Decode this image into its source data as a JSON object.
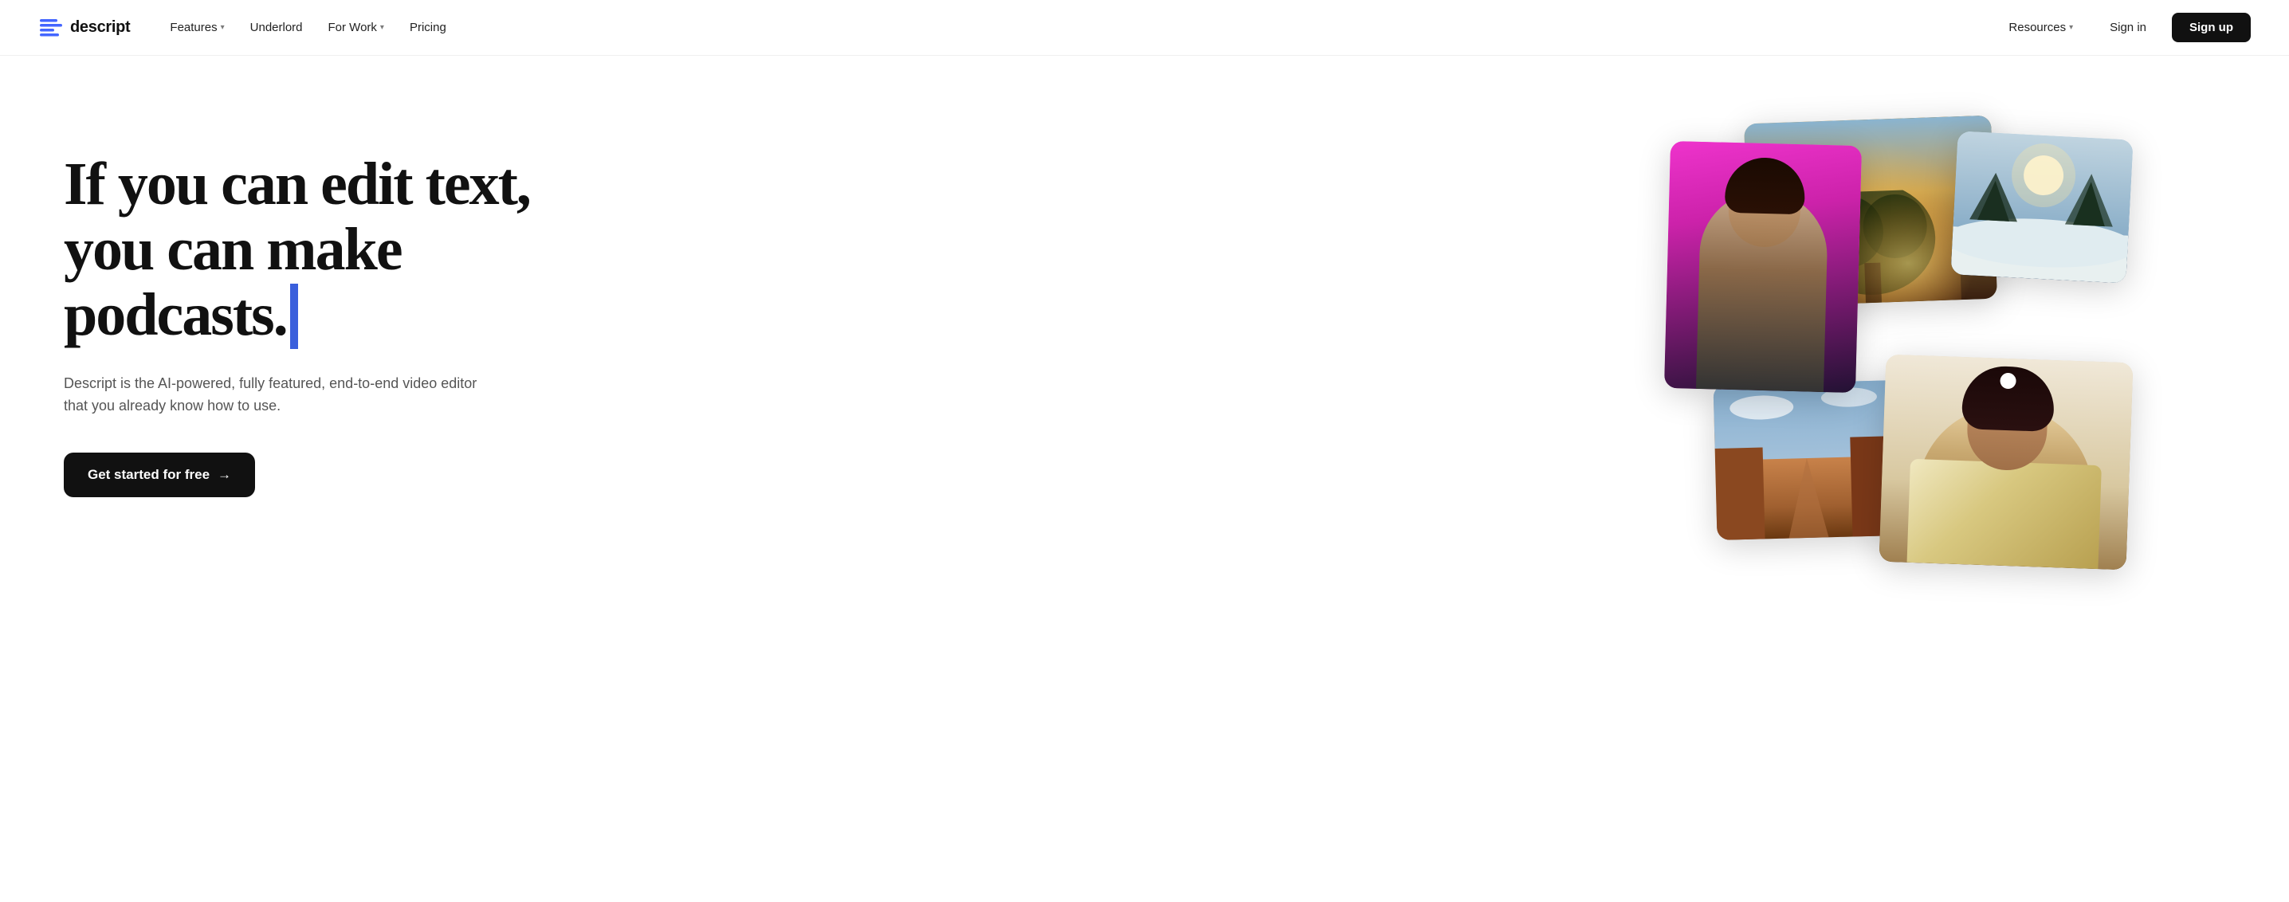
{
  "nav": {
    "logo_text": "descript",
    "links": [
      {
        "label": "Features",
        "has_dropdown": true
      },
      {
        "label": "Underlord",
        "has_dropdown": false
      },
      {
        "label": "For Work",
        "has_dropdown": true
      },
      {
        "label": "Pricing",
        "has_dropdown": false
      }
    ],
    "right_links": [
      {
        "label": "Resources",
        "has_dropdown": true
      },
      {
        "label": "Sign in",
        "has_dropdown": false
      }
    ],
    "signup_label": "Sign up"
  },
  "hero": {
    "headline_line1": "If you can edit text,",
    "headline_line2": "you can make podcasts.",
    "subtitle": "Descript is the AI-powered, fully featured, end-to-end video editor that you already know how to use.",
    "cta_label": "Get started for free",
    "cta_arrow": "→"
  }
}
